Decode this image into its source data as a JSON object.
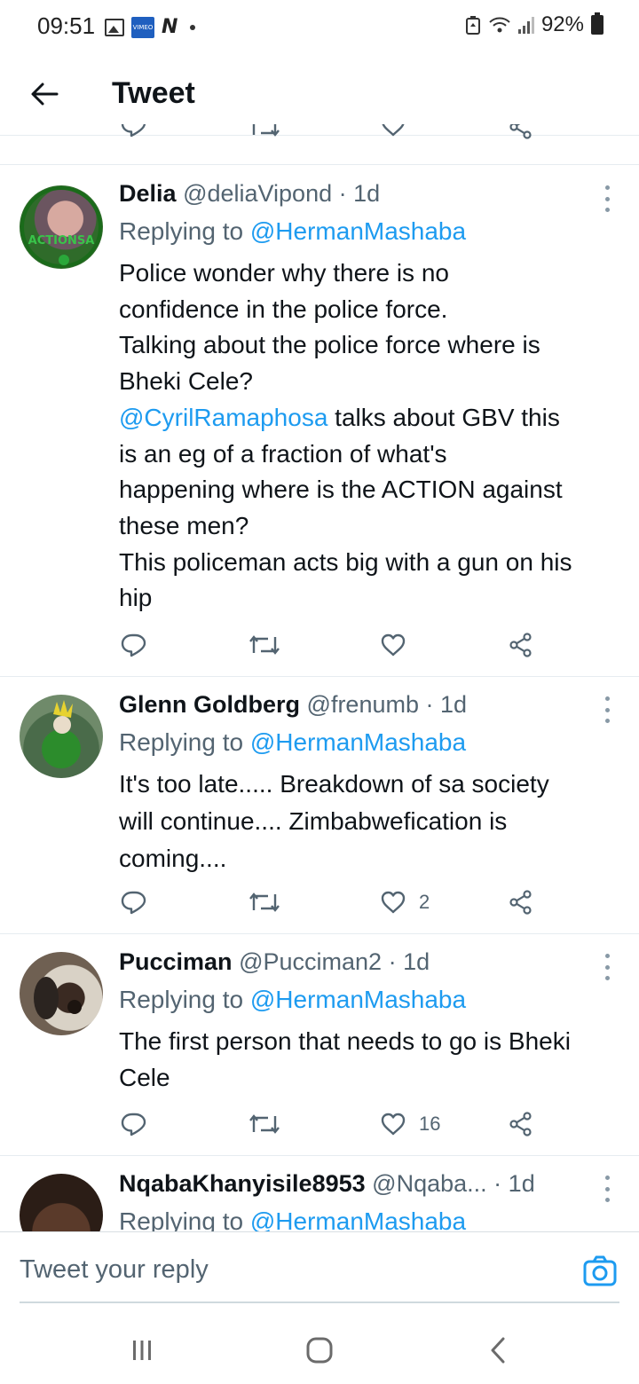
{
  "status_bar": {
    "time": "09:51",
    "app_badge": "VIMEO",
    "app_letter": "N",
    "battery": "92%"
  },
  "header": {
    "title": "Tweet"
  },
  "tweets": [
    {
      "name": "Delia",
      "handle": "@deliaVipond",
      "dot": "·",
      "time": "1d",
      "replying_prefix": "Replying to ",
      "replying_to": "@HermanMashaba",
      "avatar_text": "ACTIONSA",
      "body": [
        {
          "text": "Police wonder why there is no",
          "mention": ""
        },
        {
          "text": "confidence in the police force.",
          "mention": ""
        },
        {
          "text": "Talking about the police force where is",
          "mention": ""
        },
        {
          "text": "Bheki Cele?",
          "mention": ""
        },
        {
          "mention": "@CyrilRamaphosa",
          "text": " talks about GBV this"
        },
        {
          "text": "is an eg of a fraction of what's",
          "mention": ""
        },
        {
          "text": "happening where is the ACTION against",
          "mention": ""
        },
        {
          "text": "these men?",
          "mention": ""
        },
        {
          "text": "This policeman acts big with a gun on his",
          "mention": ""
        },
        {
          "text": "hip",
          "mention": ""
        }
      ],
      "likes": ""
    },
    {
      "name": "Glenn Goldberg",
      "handle": "@frenumb",
      "dot": "·",
      "time": "1d",
      "replying_prefix": "Replying to ",
      "replying_to": "@HermanMashaba",
      "body": [
        {
          "text": "It's too late..... Breakdown of sa society",
          "mention": ""
        },
        {
          "text": "will continue.... Zimbabwefication is",
          "mention": ""
        },
        {
          "text": "coming....",
          "mention": ""
        }
      ],
      "likes": "2"
    },
    {
      "name": "Pucciman",
      "handle": "@Pucciman2",
      "dot": "·",
      "time": "1d",
      "replying_prefix": "Replying to ",
      "replying_to": "@HermanMashaba",
      "body": [
        {
          "text": "The first person that needs to go is Bheki",
          "mention": ""
        },
        {
          "text": "Cele",
          "mention": ""
        }
      ],
      "likes": "16"
    },
    {
      "name": "NqabaKhanyisile8953",
      "handle": "@Nqaba...",
      "dot": "·",
      "time": "1d",
      "replying_prefix": "Replying to ",
      "replying_to": "@HermanMashaba"
    }
  ],
  "reply_bar": {
    "placeholder": "Tweet your reply"
  },
  "icons": {
    "reply": "speech-bubble",
    "retweet": "retweet-arrows",
    "like": "heart-outline",
    "share": "share-nodes",
    "camera": "camera-outline",
    "more": "vertical-ellipsis"
  },
  "colors": {
    "mention": "#1d9bf0",
    "secondary_text": "#536471",
    "icon": "#536471",
    "divider": "#e6ecf0"
  }
}
